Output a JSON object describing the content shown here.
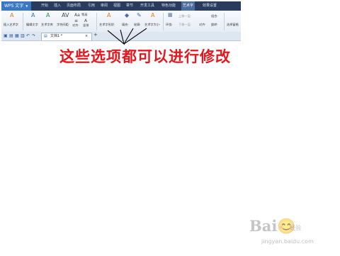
{
  "app": {
    "name": "WPS 文字",
    "caret": "▼"
  },
  "menu_tabs": [
    "开始",
    "插入",
    "页面布局",
    "引用",
    "审阅",
    "视图",
    "章节",
    "开发工具",
    "特色功能",
    "艺术字",
    "效果设置"
  ],
  "active_tab": "艺术字",
  "ribbon": {
    "insert_wordart": {
      "icon": "A",
      "label": "插入艺术字"
    },
    "edit_text": {
      "icon": "A",
      "label": "编辑文字"
    },
    "wordart_gallery": {
      "icon": "A",
      "label": "艺术字库"
    },
    "shape_text": {
      "icon": "AV",
      "label": "字符间距·"
    },
    "equal_height": {
      "icon": "Aa",
      "label": "等高"
    },
    "align": {
      "icon": "≡",
      "label": "对齐·"
    },
    "vertical": {
      "icon": "A",
      "label": "竖排"
    },
    "wordart_shape": {
      "icon": "A",
      "label": "艺术字形状·"
    },
    "fill": {
      "icon": "◆",
      "label": "填充·"
    },
    "line": {
      "icon": "✎",
      "label": "轮廓·"
    },
    "wordart_size": {
      "icon": "A",
      "label": "艺术字大小·"
    },
    "wrap": {
      "icon": "▦",
      "label": "环绕·"
    },
    "bring_forward": {
      "label": "上移一层·"
    },
    "send_backward": {
      "label": "下移一层·"
    },
    "align2": {
      "label": "对齐·"
    },
    "group": {
      "label": "组合·"
    },
    "rotate": {
      "label": "旋转·"
    },
    "select_pane": {
      "label": "选择窗格"
    }
  },
  "document_tab": {
    "title": "文档1 *",
    "close": "×",
    "new_tab": "+"
  },
  "caption": "这些选项都可以进行修改",
  "watermark": {
    "logo": "Bai😊",
    "sub": "经验",
    "url": "jingyan.baidu.com"
  }
}
